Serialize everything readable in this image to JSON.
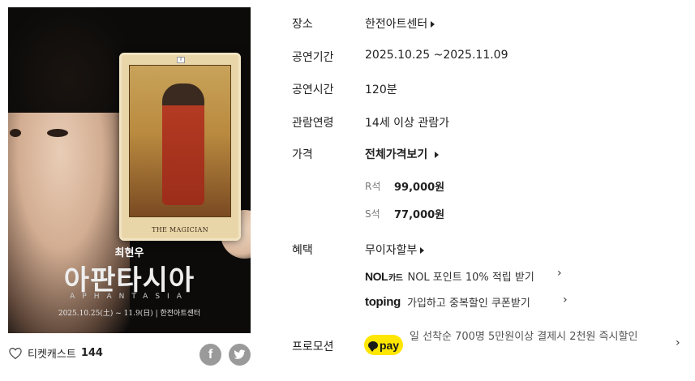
{
  "poster": {
    "actor": "최현우",
    "title": "아판타시아",
    "subtitle": "APHANTASIA",
    "info": "2025.10.25(土) ~ 11.9(日) | 한전아트센터",
    "card_title": "THE MAGICIAN",
    "card_number": "I"
  },
  "cast": {
    "label": "티켓캐스트",
    "count": "144"
  },
  "share": {
    "facebook_glyph": "f"
  },
  "rows": {
    "venue": {
      "label": "장소",
      "value": "한전아트센터"
    },
    "period": {
      "label": "공연기간",
      "value": "2025.10.25 ~2025.11.09"
    },
    "runtime": {
      "label": "공연시간",
      "value": "120분"
    },
    "age": {
      "label": "관람연령",
      "value": "14세 이상 관람가"
    },
    "price": {
      "label": "가격",
      "link": "전체가격보기",
      "seats": [
        {
          "grade": "R석",
          "price": "99,000원"
        },
        {
          "grade": "S석",
          "price": "77,000원"
        }
      ]
    },
    "benefit": {
      "label": "혜택",
      "link": "무이자할부",
      "nol": {
        "logo_main": "NOL",
        "logo_sub": "카드",
        "text": "NOL 포인트 10% 적립 받기"
      },
      "toping": {
        "logo": "toping",
        "text": "가입하고 중복할인 쿠폰받기"
      }
    },
    "promotion": {
      "label": "프로모션",
      "badge": "pay",
      "text": "일 선착순 700명 5만원이상 결제시 2천원 즉시할인"
    }
  },
  "colors": {
    "accent_blue": "#2b6cf6",
    "kakao_yellow": "#ffe600"
  }
}
